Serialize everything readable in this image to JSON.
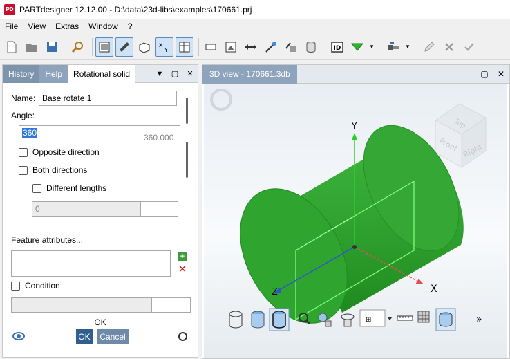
{
  "window": {
    "title": "PARTdesigner 12.12.00 - D:\\data\\23d-libs\\examples\\170661.prj",
    "icon_text": "PD"
  },
  "menu": [
    "File",
    "View",
    "Extras",
    "Window",
    "?"
  ],
  "toolbar": {
    "icons": [
      "new-document-icon",
      "open-folder-icon",
      "save-icon",
      "search-icon",
      "list-view-icon",
      "sketch-icon",
      "box-icon",
      "xyz-axis-icon",
      "table-icon",
      "cylinder-tool-icon",
      "image-frame-icon",
      "dimension-icon",
      "magic-wand-icon",
      "export-icon",
      "database-icon",
      "id-icon",
      "filter-icon",
      "save-drop-icon",
      "bolt-icon",
      "edit-icon",
      "delete-icon",
      "check-icon"
    ]
  },
  "left_panel": {
    "tabs": [
      "History",
      "Help",
      "Rotational solid"
    ],
    "name_label": "Name:",
    "name_value": "Base rotate 1",
    "angle_label": "Angle:",
    "angle_value": "360",
    "angle_result": "= 360.000",
    "opposite_direction": "Opposite direction",
    "both_directions": "Both directions",
    "different_lengths": "Different lengths",
    "length_value": "0",
    "feature_attributes": "Feature attributes...",
    "condition": "Condition",
    "ok_text": "OK",
    "ok_button": "OK",
    "cancel_button": "Cancel"
  },
  "view": {
    "tab_title": "3D view - 170661.3db",
    "axes": {
      "x": "X",
      "y": "Y",
      "z": "Z"
    },
    "cube_faces": {
      "top": "Top",
      "front": "Front",
      "right": "Right"
    },
    "solid_color": "#2fa52f",
    "more": "»"
  }
}
